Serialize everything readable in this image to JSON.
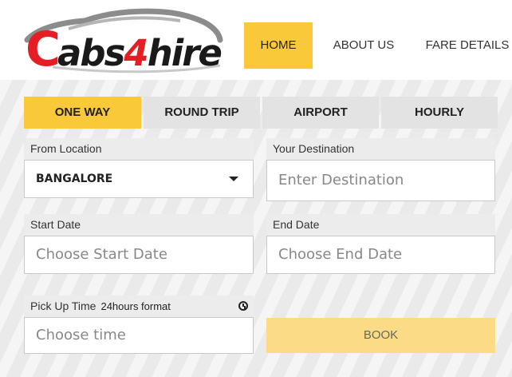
{
  "brand": {
    "logo_c": "C",
    "logo_abs": "abs",
    "logo_four": "4",
    "logo_hire": "hire",
    "accent_color": "#e31e24",
    "highlight_color": "#f9c93a"
  },
  "nav": {
    "home": "HOME",
    "about": "ABOUT US",
    "fare": "FARE DETAILS"
  },
  "tabs": {
    "one_way": "ONE WAY",
    "round_trip": "ROUND TRIP",
    "airport": "AIRPORT",
    "hourly": "HOURLY",
    "active": "ONE WAY"
  },
  "form": {
    "from_label": "From Location",
    "from_value": "BANGALORE",
    "dest_label": "Your Destination",
    "dest_placeholder": "Enter Destination",
    "start_label": "Start Date",
    "start_placeholder": "Choose Start Date",
    "end_label": "End Date",
    "end_placeholder": "Choose End Date",
    "pickup_label": "Pick Up Time",
    "pickup_hint": "24hours format",
    "pickup_placeholder": "Choose time",
    "book_label": "BOOK"
  },
  "icons": {
    "dropdown": "chevron-down-icon",
    "clock": "clock-icon",
    "car": "car-outline-icon"
  }
}
